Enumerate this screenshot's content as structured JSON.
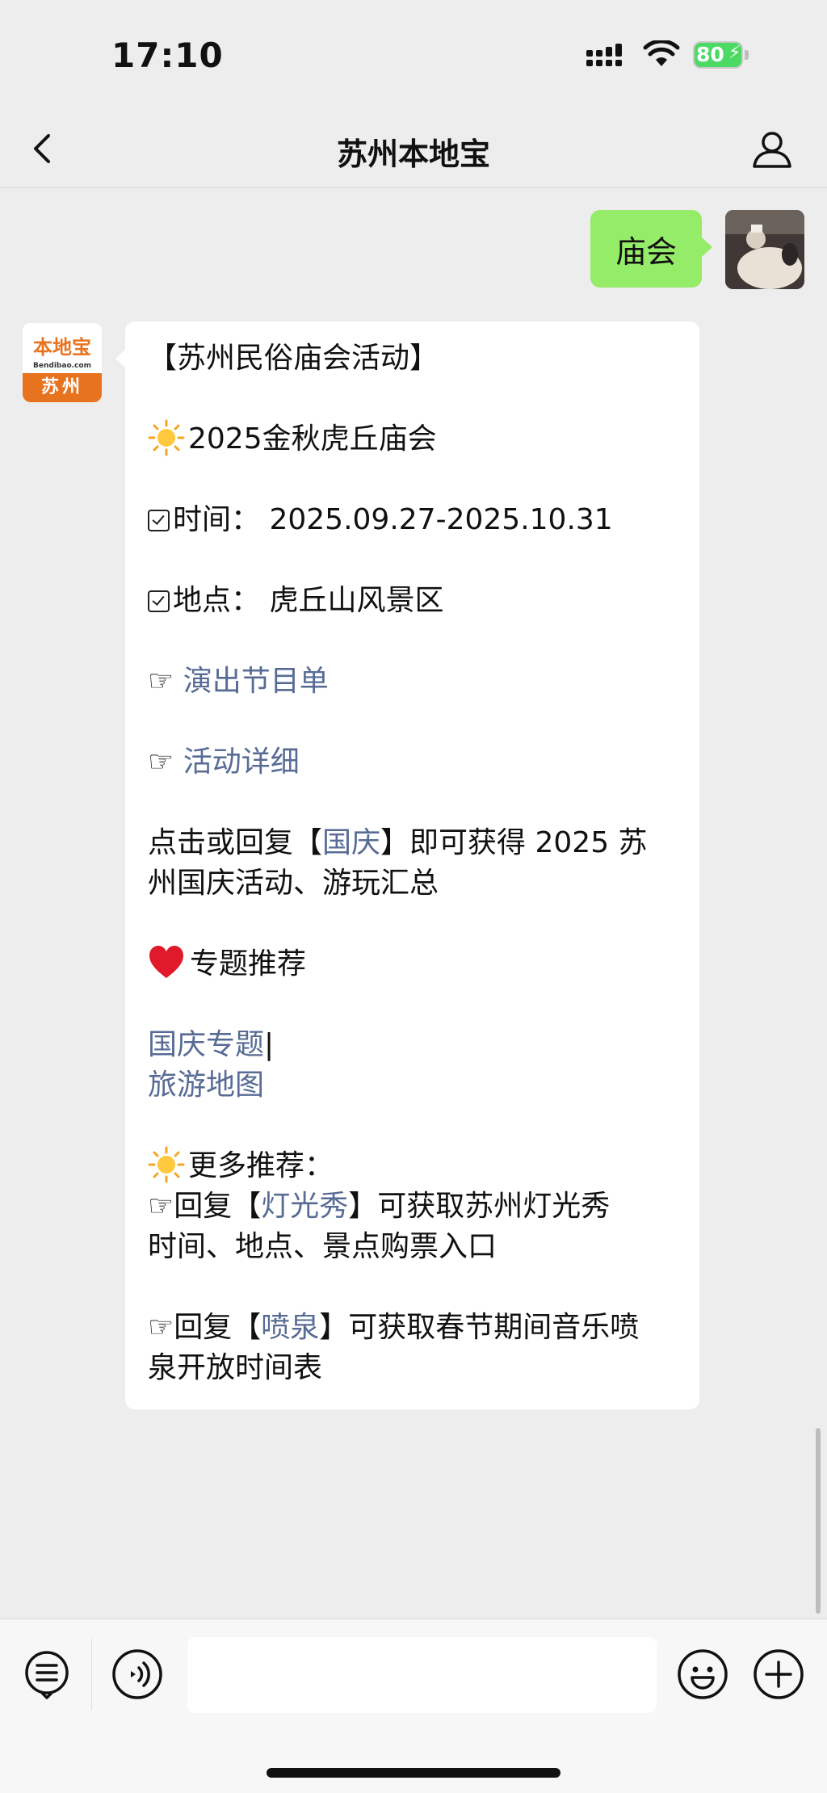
{
  "status_bar": {
    "time": "17:10",
    "battery_percent": "80",
    "icons": [
      "signal-icon",
      "wifi-icon",
      "battery-charging-icon"
    ]
  },
  "nav": {
    "title": "苏州本地宝",
    "back_icon": "chevron-left-icon",
    "profile_icon": "person-icon"
  },
  "sent_message": {
    "text": "庙会"
  },
  "bot_avatar": {
    "logo_text": "本地宝",
    "logo_url": "Bendibao.com",
    "logo_city": "苏州",
    "brand_color": "#e8731f"
  },
  "received_message": {
    "heading": "【苏州民俗庙会活动】",
    "event_title": "2025金秋虎丘庙会",
    "time_label": "时间：",
    "time_value": "2025.09.27-2025.10.31",
    "place_label": "地点：",
    "place_value": "虎丘山风景区",
    "link1_prefix": "☞ ",
    "link1": "演出节目单",
    "link2_prefix": "☞ ",
    "link2": "活动详细",
    "guoqing_pre": "点击或回复【",
    "guoqing_kw": "国庆",
    "guoqing_post": "】即可获得 2025 苏",
    "guoqing_line2": "州国庆活动、游玩汇总",
    "topic_title": "专题推荐",
    "topic_link1": "国庆专题",
    "topic_sep": "|",
    "topic_link2": "旅游地图",
    "more_title": "更多推荐：",
    "more1_pre": "☞回复【",
    "more1_kw": "灯光秀",
    "more1_post": "】可获取苏州灯光秀",
    "more1_line2": "时间、地点、景点购票入口",
    "more2_pre": "☞回复【",
    "more2_kw": "喷泉",
    "more2_post": "】可获取春节期间音乐喷",
    "more2_line2": "泉开放时间表"
  },
  "toolbar": {
    "icons": [
      "menu-list-icon",
      "voice-icon",
      "emoji-icon",
      "plus-icon"
    ],
    "input_value": ""
  },
  "colors": {
    "sent_bubble": "#95ec69",
    "link": "#576b95",
    "background": "#ededed"
  }
}
